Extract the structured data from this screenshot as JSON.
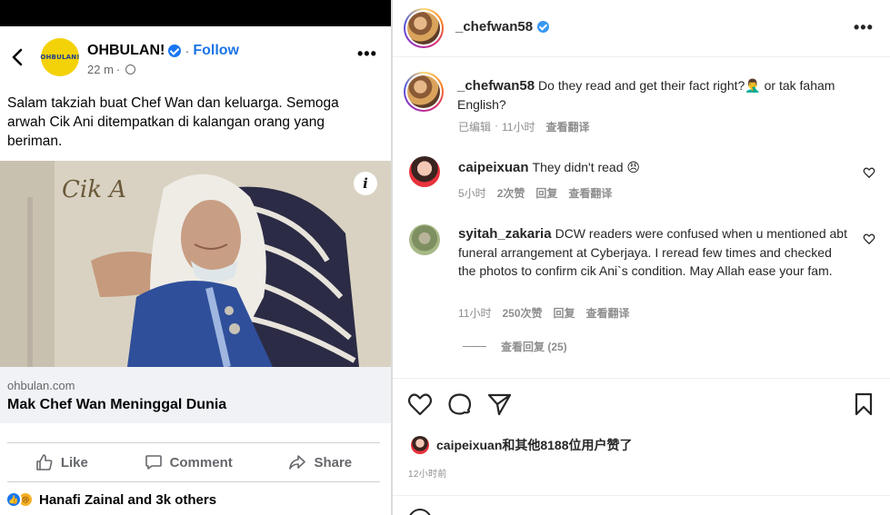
{
  "facebook": {
    "page_name": "OHBULAN!",
    "logo_text": "OHBULAN!",
    "follow_label": "Follow",
    "time_ago": "22 m",
    "post_text": "Salam takziah buat Chef Wan dan keluarga. Semoga arwah Cik Ani ditempatkan di kalangan orang yang beriman.",
    "link_domain": "ohbulan.com",
    "link_title": "Mak Chef Wan Meninggal Dunia",
    "actions": {
      "like": "Like",
      "comment": "Comment",
      "share": "Share"
    },
    "reactions_text": "Hanafi Zainal and 3k others",
    "image_caption": "Cik A",
    "icons": [
      "back-arrow-icon",
      "verified-icon",
      "globe-icon",
      "more-icon",
      "info-icon",
      "like-icon",
      "comment-icon",
      "share-icon"
    ]
  },
  "instagram": {
    "username": "_chefwan58",
    "caption": {
      "username": "_chefwan58",
      "text": "Do they read and get their fact right?🤦‍♂️ or tak faham English?",
      "edited": "已编辑",
      "time": "11小时",
      "translate": "查看翻译"
    },
    "comments": [
      {
        "username": "caipeixuan",
        "text": "They didn't read 😠",
        "time": "5小时",
        "likes": "2次赞",
        "reply": "回复",
        "translate": "查看翻译"
      },
      {
        "username": "syitah_zakaria",
        "text": "DCW readers were confused when u mentioned abt funeral arrangement at Cyberjaya. I reread few times and checked the photos to confirm cik Ani`s condition. May Allah ease your fam.",
        "time": "11小时",
        "likes": "250次赞",
        "reply": "回复",
        "translate": "查看翻译"
      }
    ],
    "view_replies": "查看回复 (25)",
    "likes_text": "caipeixuan和其他8188位用户赞了",
    "post_time": "12小时前",
    "colors": {
      "verified": "#3897f0",
      "text": "#262626",
      "muted": "#8e8e8e"
    }
  },
  "colors": {
    "fb_blue": "#1877f2",
    "fb_follow": "#1b74e4",
    "fb_muted": "#65676b",
    "fb_link_bg": "#f0f2f5"
  }
}
